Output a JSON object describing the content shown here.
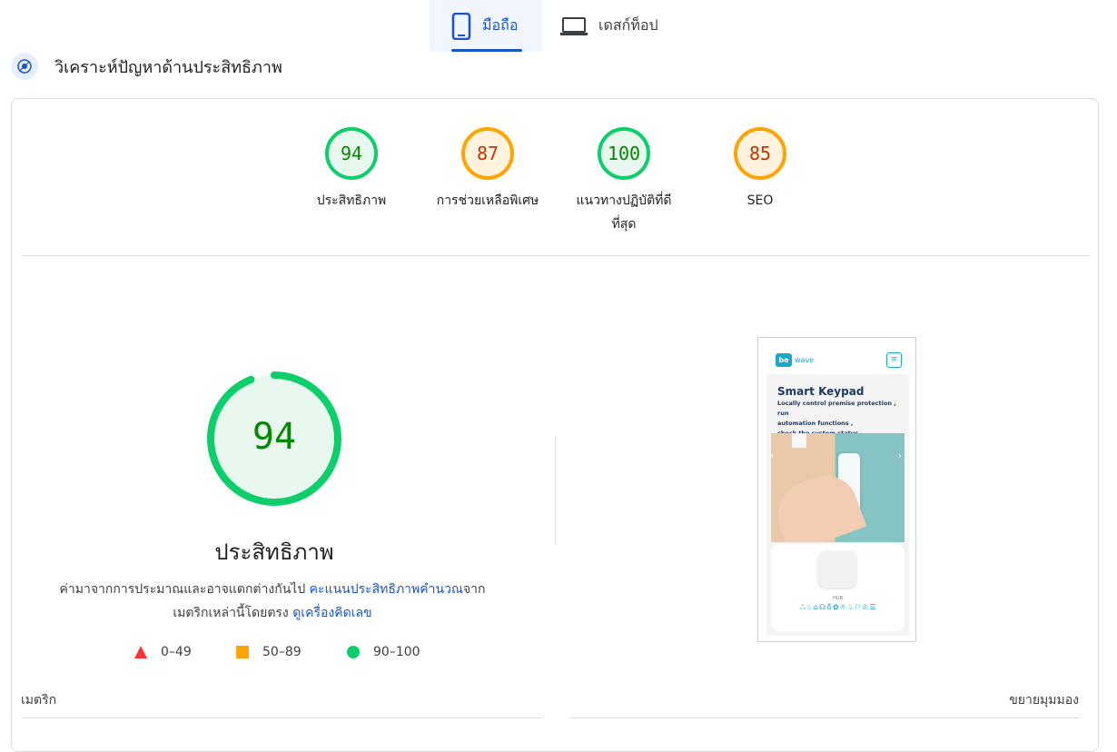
{
  "tabs": [
    {
      "label": "มือถือ",
      "icon": "smartphone-icon",
      "active": true
    },
    {
      "label": "เดสก์ท็อป",
      "icon": "laptop-icon",
      "active": false
    }
  ],
  "header": {
    "title": "วิเคราะห์ปัญหาด้านประสิทธิภาพ",
    "icon": "lighthouse-icon"
  },
  "scores": [
    {
      "label": "ประสิทธิภาพ",
      "value": 94,
      "status": "pass"
    },
    {
      "label": "การช่วยเหลือพิเศษ",
      "value": 87,
      "status": "average"
    },
    {
      "label_line1": "แนวทางปฏิบัติที่ดี",
      "label_line2": "ที่สุด",
      "value": 100,
      "status": "pass"
    },
    {
      "label": "SEO",
      "value": 85,
      "status": "average"
    }
  ],
  "performance": {
    "value": 94,
    "title": "ประสิทธิภาพ",
    "desc_part1": "ค่ามาจากการประมาณและอาจแตกต่างกันไป ",
    "desc_link1": "คะแนนประสิทธิภาพคำนวณ",
    "desc_part2": "จาก",
    "desc_part3": "เมตริกเหล่านี้โดยตรง ",
    "desc_link2": "ดูเครื่องคิดเลข"
  },
  "legend": [
    {
      "range": "0–49",
      "shape": "triangle"
    },
    {
      "range": "50–89",
      "shape": "square"
    },
    {
      "range": "90–100",
      "shape": "circle"
    }
  ],
  "metrics_label": "เมตริก",
  "expand_label": "ขยายมุมมอง",
  "screenshot": {
    "logo_mark": "be",
    "logo_text": "wave",
    "menu_glyph": "≡",
    "title": "Smart Keypad",
    "text_line1": "Locally control premise protection , run",
    "text_line2": "automation functions ,",
    "text_line3": "check the system status",
    "arrow_left": "‹",
    "arrow_right": "›",
    "hub_label": "HUB",
    "icons_row": "ஃ♨⌂☊♁✿☼♧⚐♔☰"
  },
  "colors": {
    "pass": "#0cce6b",
    "pass_text": "#008800",
    "pass_bg": "#e8f8ee",
    "average": "#ffa400",
    "average_text": "#c33300",
    "average_bg": "#fff3e0",
    "fail": "#ff3333",
    "accent": "#1a55c7"
  }
}
